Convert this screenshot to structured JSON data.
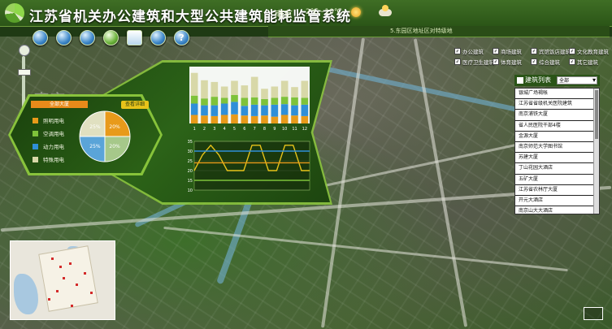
{
  "header": {
    "title": "江苏省机关办公建筑和大型公共建筑能耗监管系统",
    "city": "南京",
    "temperature": "2℃~10℃",
    "sub_text": "5.东园区地址区对特级地"
  },
  "toolbar": {
    "items": [
      {
        "icon": "globe-icon"
      },
      {
        "icon": "monitor-icon"
      },
      {
        "icon": "search-icon"
      },
      {
        "icon": "home-icon"
      },
      {
        "icon": "document-icon"
      },
      {
        "icon": "camera-icon"
      },
      {
        "icon": "help-icon",
        "label": "?"
      }
    ]
  },
  "map": {
    "label": "南京"
  },
  "panel": {
    "legend_title": "全部大厦",
    "detail_button": "查看详细",
    "legend": [
      {
        "label": "照明用电",
        "color": "#e89a1a"
      },
      {
        "label": "空调用电",
        "color": "#7ec23a"
      },
      {
        "label": "动力用电",
        "color": "#2f8fd8"
      },
      {
        "label": "特殊用电",
        "color": "#d8d8a8"
      }
    ]
  },
  "chart_data": [
    {
      "type": "pie",
      "slices": [
        {
          "label": "照明用电",
          "value": 25,
          "text": "20%",
          "color": "#e89a1a"
        },
        {
          "label": "空调用电",
          "value": 25,
          "text": "20%",
          "color": "#a6c88a"
        },
        {
          "label": "动力用电",
          "value": 25,
          "text": "25%",
          "color": "#5aa4d8"
        },
        {
          "label": "特殊用电",
          "value": 25,
          "text": "25%",
          "color": "#e0e0c0"
        }
      ]
    },
    {
      "type": "bar",
      "categories": [
        "1",
        "2",
        "3",
        "4",
        "5",
        "6",
        "7",
        "8",
        "9",
        "10",
        "11",
        "12"
      ],
      "ylim": [
        0,
        100
      ],
      "series": [
        {
          "values": [
            15,
            14,
            13,
            15,
            16,
            14,
            13,
            14,
            12,
            15,
            14,
            13
          ],
          "color": "#e89a1a"
        },
        {
          "values": [
            20,
            18,
            19,
            20,
            22,
            17,
            20,
            18,
            21,
            19,
            18,
            20
          ],
          "color": "#2f8fd8"
        },
        {
          "values": [
            14,
            12,
            15,
            10,
            12,
            14,
            13,
            11,
            12,
            13,
            14,
            12
          ],
          "color": "#7ec23a"
        },
        {
          "values": [
            40,
            32,
            26,
            20,
            25,
            22,
            36,
            18,
            20,
            28,
            18,
            30
          ],
          "color": "#d8d8a8"
        }
      ]
    },
    {
      "type": "line",
      "yticks": [
        "35",
        "30",
        "25",
        "20",
        "15",
        "10"
      ],
      "ylim": [
        10,
        35
      ],
      "series": [
        {
          "values": [
            20,
            28,
            33,
            28,
            20,
            20,
            20,
            33,
            33,
            20,
            20,
            33,
            33,
            20,
            20
          ],
          "color": "#e8c31a"
        },
        {
          "values": [
            30,
            30,
            30,
            30,
            30,
            30,
            30,
            30,
            30,
            30,
            30,
            30,
            30,
            30,
            30
          ],
          "color": "#2f8fd8"
        },
        {
          "values": [
            24,
            24,
            24,
            24,
            24,
            24,
            24,
            24,
            24,
            24,
            24,
            24,
            24,
            24,
            24
          ],
          "color": "#e89a1a"
        },
        {
          "values": [
            15,
            15,
            15,
            15,
            15,
            15,
            15,
            15,
            15,
            15,
            15,
            15,
            15,
            15,
            15
          ],
          "color": "#7ec23a"
        }
      ]
    }
  ],
  "checkboxes": [
    {
      "label": "办公建筑",
      "checked": true
    },
    {
      "label": "商场建筑",
      "checked": true
    },
    {
      "label": "宾馆饭店建筑",
      "checked": true
    },
    {
      "label": "文化教育建筑",
      "checked": true
    },
    {
      "label": "医疗卫生建筑",
      "checked": true
    },
    {
      "label": "体育建筑",
      "checked": true
    },
    {
      "label": "综合建筑",
      "checked": true
    },
    {
      "label": "其它建筑",
      "checked": true
    }
  ],
  "building_list": {
    "title": "建筑列表",
    "select_value": "全部",
    "items": [
      "银城广场褐帐",
      "江苏省省级机关医院建筑",
      "南京浦铁大厦",
      "省人民医院干部4楼",
      "金源大厦",
      "南京师范大学图书馆",
      "苏建大厦",
      "丁山花园大酒店",
      "五矿大厦",
      "江苏省农林厅大厦",
      "开元大酒店",
      "南京山大大酒店"
    ]
  }
}
